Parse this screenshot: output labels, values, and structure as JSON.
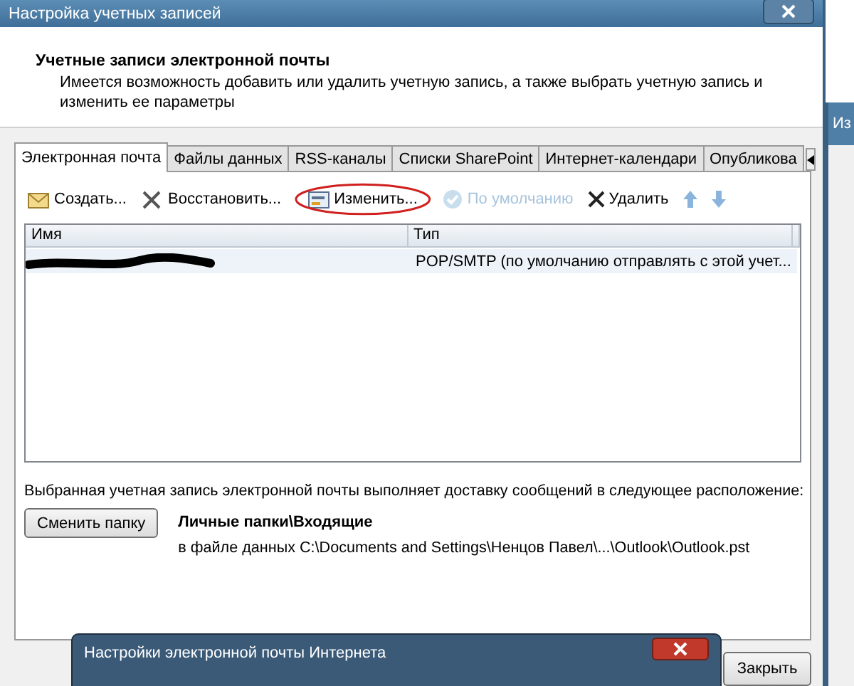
{
  "window": {
    "title": "Настройка учетных записей"
  },
  "header": {
    "title": "Учетные записи электронной почты",
    "description": "Имеется возможность добавить или удалить учетную запись, а также выбрать учетную запись и изменить ее параметры"
  },
  "tabs": [
    {
      "label": "Электронная почта",
      "selected": true
    },
    {
      "label": "Файлы данных",
      "selected": false
    },
    {
      "label": "RSS-каналы",
      "selected": false
    },
    {
      "label": "Списки SharePoint",
      "selected": false
    },
    {
      "label": "Интернет-календари",
      "selected": false
    },
    {
      "label": "Опубликова",
      "selected": false
    }
  ],
  "toolbar": [
    {
      "kind": "new",
      "label": "Создать...",
      "disabled": false,
      "circled": false
    },
    {
      "kind": "repair",
      "label": "Восстановить...",
      "disabled": false,
      "circled": false
    },
    {
      "kind": "change",
      "label": "Изменить...",
      "disabled": false,
      "circled": true
    },
    {
      "kind": "default",
      "label": "По умолчанию",
      "disabled": true,
      "circled": false
    },
    {
      "kind": "delete",
      "label": "Удалить",
      "disabled": false,
      "circled": false
    },
    {
      "kind": "up",
      "disabled": false,
      "circled": false
    },
    {
      "kind": "down",
      "disabled": false,
      "circled": false
    }
  ],
  "table": {
    "columns": [
      "Имя",
      "Тип"
    ],
    "rows": [
      {
        "name_redacted": true,
        "type": "POP/SMTP (по умолчанию отправлять с этой учет..."
      }
    ]
  },
  "delivery": {
    "text": "Выбранная учетная запись электронной почты выполняет доставку сообщений в следующее расположение:",
    "button": "Сменить папку",
    "folder": "Личные папки\\Входящие",
    "file": "в файле данных C:\\Documents and Settings\\Ненцов Павел\\...\\Outlook\\Outlook.pst"
  },
  "close_button": "Закрыть",
  "side_window": {
    "title": "Из"
  },
  "bottom_window": {
    "title": "Настройки электронной почты Интернета"
  }
}
